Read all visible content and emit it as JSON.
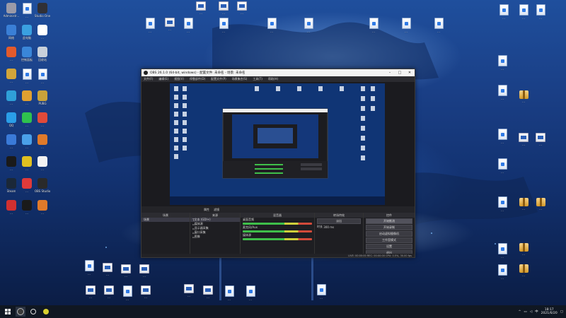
{
  "desktop": {
    "icons_left": [
      {
        "name": "icon-admin",
        "label": "Administr...",
        "kind": "app",
        "color": "#9a9aa8"
      },
      {
        "name": "icon-doc",
        "label": "...",
        "kind": "doc",
        "color": ""
      },
      {
        "name": "icon-studio",
        "label": "Studio One",
        "kind": "app",
        "color": "#303036"
      },
      {
        "name": "icon-network",
        "label": "网络",
        "kind": "app",
        "color": "#3a7fd6"
      },
      {
        "name": "icon-computer",
        "label": "此电脑",
        "kind": "app",
        "color": "#3aa0e0"
      },
      {
        "name": "icon-app1",
        "label": "...",
        "kind": "app",
        "color": "#ffffff"
      },
      {
        "name": "icon-app2",
        "label": "...",
        "kind": "app",
        "color": "#e25a2c"
      },
      {
        "name": "icon-control",
        "label": "控制面板",
        "kind": "app",
        "color": "#3a86d8"
      },
      {
        "name": "icon-recycle",
        "label": "回收站",
        "kind": "app",
        "color": "#c8d0da"
      },
      {
        "name": "icon-app3",
        "label": "...",
        "kind": "app",
        "color": "#d2a53a"
      },
      {
        "name": "icon-app4",
        "label": "...",
        "kind": "doc",
        "color": ""
      },
      {
        "name": "icon-app5",
        "label": "...",
        "kind": "doc",
        "color": ""
      },
      {
        "name": "icon-edge",
        "label": "...",
        "kind": "app",
        "color": "#2fa0d8"
      },
      {
        "name": "icon-game",
        "label": "...",
        "kind": "app",
        "color": "#e0a030"
      },
      {
        "name": "icon-pubg",
        "label": "PUBG",
        "kind": "app",
        "color": "#c9a23a"
      },
      {
        "name": "icon-qq",
        "label": "QQ",
        "kind": "app",
        "color": "#2a9ee8"
      },
      {
        "name": "icon-iqiyi",
        "label": "...",
        "kind": "app",
        "color": "#2fc24e"
      },
      {
        "name": "icon-app6",
        "label": "...",
        "kind": "app",
        "color": "#e04a3a"
      },
      {
        "name": "icon-app7",
        "label": "...",
        "kind": "app",
        "color": "#3a7ad8"
      },
      {
        "name": "icon-app8",
        "label": "...",
        "kind": "app",
        "color": "#4aa0e8"
      },
      {
        "name": "icon-app9",
        "label": "...",
        "kind": "app",
        "color": "#e07a2a"
      },
      {
        "name": "icon-app10",
        "label": "...",
        "kind": "app",
        "color": "#1a1a1a"
      },
      {
        "name": "icon-app11",
        "label": "...",
        "kind": "app",
        "color": "#e0c020"
      },
      {
        "name": "icon-app12",
        "label": "...",
        "kind": "app",
        "color": "#f2f2f2"
      },
      {
        "name": "icon-steam",
        "label": "Steam",
        "kind": "app",
        "color": "#1b2838"
      },
      {
        "name": "icon-netease",
        "label": "...",
        "kind": "app",
        "color": "#e03a3a"
      },
      {
        "name": "icon-obs",
        "label": "OBS Studio",
        "kind": "app",
        "color": "#2a2a2a"
      },
      {
        "name": "icon-app13",
        "label": "...",
        "kind": "app",
        "color": "#d03030"
      },
      {
        "name": "icon-app14",
        "label": "...",
        "kind": "app",
        "color": "#1a1a1a"
      },
      {
        "name": "icon-app15",
        "label": "...",
        "kind": "app",
        "color": "#e07a2a"
      }
    ],
    "icons_top": [
      {
        "name": "icon-top-1",
        "label": "...",
        "kind": "thumb"
      },
      {
        "name": "icon-top-2",
        "label": "...",
        "kind": "thumb"
      },
      {
        "name": "icon-top-3",
        "label": "...",
        "kind": "thumb"
      },
      {
        "name": "icon-top-4",
        "label": "...",
        "kind": "doc"
      },
      {
        "name": "icon-top-5",
        "label": "...",
        "kind": "thumb"
      },
      {
        "name": "icon-top-6",
        "label": "...",
        "kind": "doc"
      },
      {
        "name": "icon-top-7",
        "label": "...",
        "kind": "doc"
      },
      {
        "name": "icon-top-8",
        "label": "...",
        "kind": "doc"
      },
      {
        "name": "icon-top-9",
        "label": "...",
        "kind": "doc"
      },
      {
        "name": "icon-top-10",
        "label": "...",
        "kind": "doc"
      },
      {
        "name": "icon-top-11",
        "label": "...",
        "kind": "doc"
      },
      {
        "name": "icon-top-12",
        "label": "...",
        "kind": "doc"
      }
    ],
    "icons_right": [
      {
        "name": "icon-right-1",
        "label": "...",
        "kind": "doc"
      },
      {
        "name": "icon-right-2",
        "label": "...",
        "kind": "doc"
      },
      {
        "name": "icon-right-3",
        "label": "...",
        "kind": "doc"
      },
      {
        "name": "icon-right-4",
        "label": "...",
        "kind": "doc"
      },
      {
        "name": "icon-right-5",
        "label": "...",
        "kind": "doc"
      },
      {
        "name": "icon-right-6",
        "label": "...",
        "kind": "zip"
      },
      {
        "name": "icon-right-7",
        "label": "...",
        "kind": "doc"
      },
      {
        "name": "icon-right-8",
        "label": "...",
        "kind": "thumb"
      },
      {
        "name": "icon-right-9",
        "label": "...",
        "kind": "thumb"
      },
      {
        "name": "icon-right-10",
        "label": "...",
        "kind": "doc"
      },
      {
        "name": "icon-right-11",
        "label": "...",
        "kind": "doc"
      },
      {
        "name": "icon-right-12",
        "label": "...",
        "kind": "zip"
      },
      {
        "name": "icon-right-13",
        "label": "...",
        "kind": "zip"
      },
      {
        "name": "icon-right-14",
        "label": "...",
        "kind": "doc"
      },
      {
        "name": "icon-right-15",
        "label": "...",
        "kind": "zip"
      },
      {
        "name": "icon-right-16",
        "label": "...",
        "kind": "doc"
      },
      {
        "name": "icon-right-17",
        "label": "...",
        "kind": "zip"
      }
    ],
    "icons_bottom": [
      {
        "name": "icon-bot-1",
        "label": "...",
        "kind": "doc"
      },
      {
        "name": "icon-bot-2",
        "label": "...",
        "kind": "thumb"
      },
      {
        "name": "icon-bot-3",
        "label": "...",
        "kind": "thumb"
      },
      {
        "name": "icon-bot-4",
        "label": "...",
        "kind": "thumb"
      },
      {
        "name": "icon-bot-5",
        "label": "...",
        "kind": "thumb"
      },
      {
        "name": "icon-bot-6",
        "label": "...",
        "kind": "thumb"
      },
      {
        "name": "icon-bot-7",
        "label": "...",
        "kind": "doc"
      },
      {
        "name": "icon-bot-8",
        "label": "...",
        "kind": "thumb"
      },
      {
        "name": "icon-bot-9",
        "label": "...",
        "kind": "thumb"
      },
      {
        "name": "icon-bot-10",
        "label": "...",
        "kind": "thumb"
      },
      {
        "name": "icon-bot-11",
        "label": "...",
        "kind": "doc"
      },
      {
        "name": "icon-bot-12",
        "label": "...",
        "kind": "doc"
      },
      {
        "name": "icon-bot-13",
        "label": "...",
        "kind": "doc"
      }
    ]
  },
  "obs": {
    "title": "OBS 26.1.0 (64-bit, windows) - 配置文件: 未命名 - 场景: 未命名",
    "menu": [
      "文件(F)",
      "编辑(E)",
      "视图(V)",
      "停靠部件(D)",
      "配置文件(P)",
      "场景集合(S)",
      "工具(T)",
      "帮助(H)"
    ],
    "controls_row": [
      "属性",
      "滤镜"
    ],
    "scenes_header": "场景",
    "scenes": [
      "场景"
    ],
    "sources_header": "来源",
    "sources": [
      "文本 (GDI+)",
      "媒体源",
      "显示器采集",
      "窗口采集",
      "图像"
    ],
    "mixer_header": "混音器",
    "mixer": [
      "桌面音频",
      "麦克风/Aux",
      "媒体源"
    ],
    "transitions_header": "转场特效",
    "transition_value": "淡出",
    "duration_label": "时长",
    "duration_value": "300 ms",
    "controls_header": "控件",
    "controls": [
      "开始推流",
      "开始录制",
      "启动虚拟摄像机",
      "工作室模式",
      "设置",
      "退出"
    ],
    "status": "LIVE: 00:00:00   REC: 00:00:00   CPU: 0.5%, 30.00 fps"
  },
  "taskbar": {
    "time": "18:17",
    "date": "2021/6/20",
    "lang": "中"
  }
}
